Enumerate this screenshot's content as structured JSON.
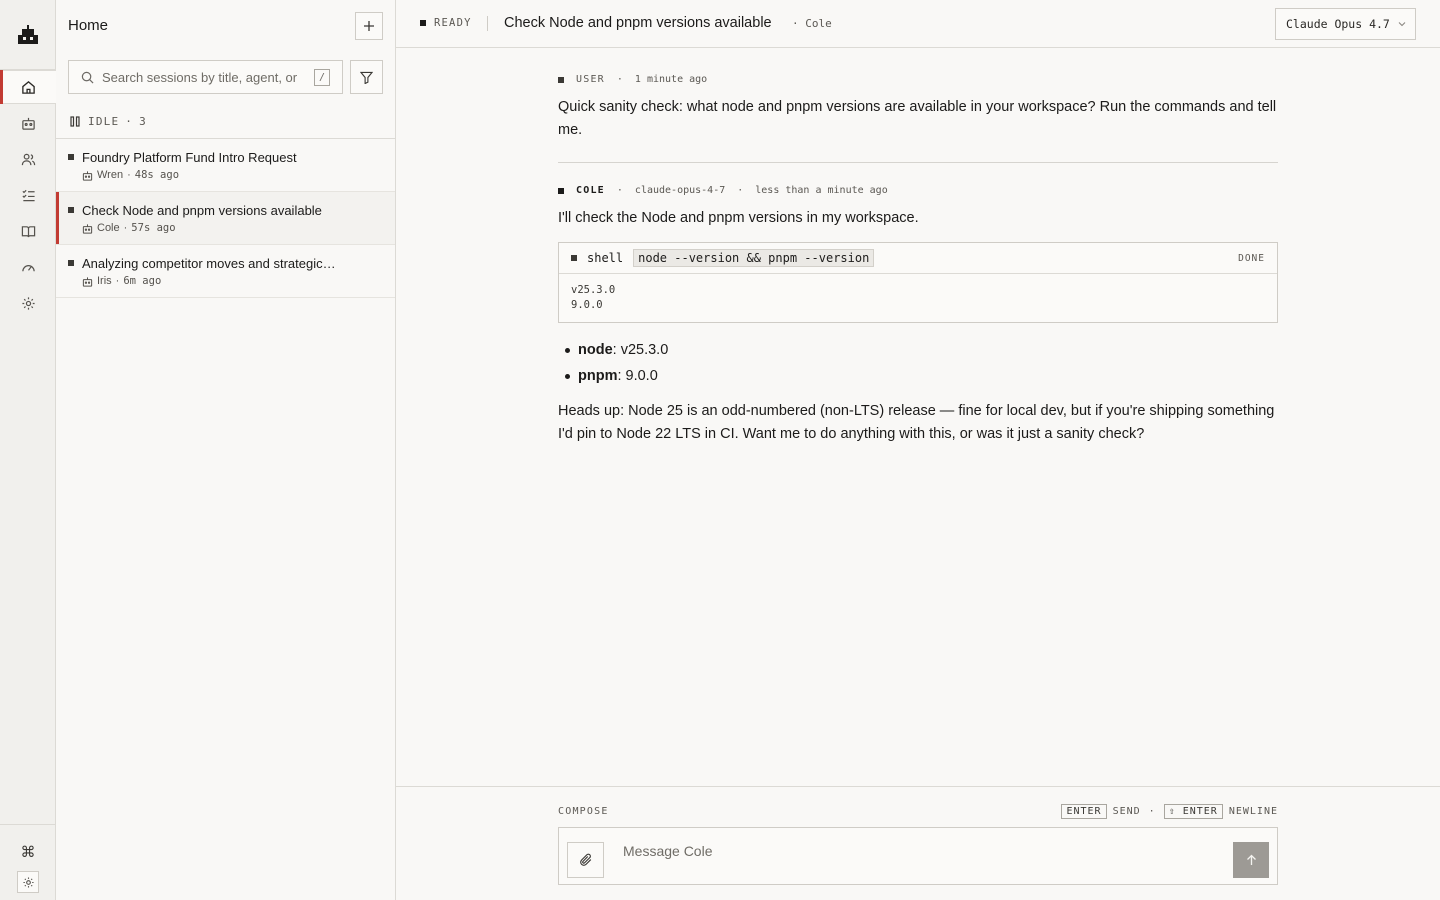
{
  "rail": {
    "logo_icon": "robot-logo-icon",
    "items": [
      {
        "icon": "home-icon",
        "active": true
      },
      {
        "icon": "bot-icon"
      },
      {
        "icon": "users-icon"
      },
      {
        "icon": "tasks-icon"
      },
      {
        "icon": "book-icon"
      },
      {
        "icon": "gauge-icon"
      },
      {
        "icon": "gear-icon"
      }
    ],
    "bottom": [
      {
        "icon": "command-icon"
      },
      {
        "icon": "sun-icon"
      }
    ]
  },
  "sidebar": {
    "title": "Home",
    "search_placeholder": "Search sessions by title, agent, or",
    "search_shortcut": "/",
    "group": {
      "label": "IDLE",
      "count": "3"
    },
    "sessions": [
      {
        "title": "Foundry Platform Fund Intro Request",
        "agent": "Wren",
        "ago": "48s ago",
        "active": false
      },
      {
        "title": "Check Node and pnpm versions available",
        "agent": "Cole",
        "ago": "57s ago",
        "active": true
      },
      {
        "title": "Analyzing competitor moves and strategic…",
        "agent": "Iris",
        "ago": "6m ago",
        "active": false
      }
    ]
  },
  "header": {
    "status": "READY",
    "title": "Check Node and pnpm versions available",
    "agent": "· Cole",
    "model": "Claude Opus 4.7"
  },
  "thread": {
    "user": {
      "role": "USER",
      "time": "1 minute ago",
      "text": "Quick sanity check: what node and pnpm versions are available in your workspace? Run the commands and tell me."
    },
    "assistant": {
      "role": "COLE",
      "model": "claude-opus-4-7",
      "time": "less than a minute ago",
      "intro": "I'll check the Node and pnpm versions in my workspace.",
      "tool": {
        "name": "shell",
        "command": "node --version && pnpm --version",
        "status": "DONE",
        "output": [
          "v25.3.0",
          "9.0.0"
        ]
      },
      "bullets": [
        {
          "key": "node",
          "value": ": v25.3.0"
        },
        {
          "key": "pnpm",
          "value": ": 9.0.0"
        }
      ],
      "closing": "Heads up: Node 25 is an odd-numbered (non-LTS) release — fine for local dev, but if you're shipping something I'd pin to Node 22 LTS in CI. Want me to do anything with this, or was it just a sanity check?"
    }
  },
  "compose": {
    "label": "COMPOSE",
    "hint_send_key": "ENTER",
    "hint_send": "SEND",
    "hint_sep": "·",
    "hint_newline_key": "⇧ ENTER",
    "hint_newline": "NEWLINE",
    "placeholder": "Message Cole"
  },
  "colors": {
    "accent": "#c23b33",
    "background": "#f9f8f6",
    "rail": "#f1f0ed",
    "border": "#dcdad5"
  }
}
